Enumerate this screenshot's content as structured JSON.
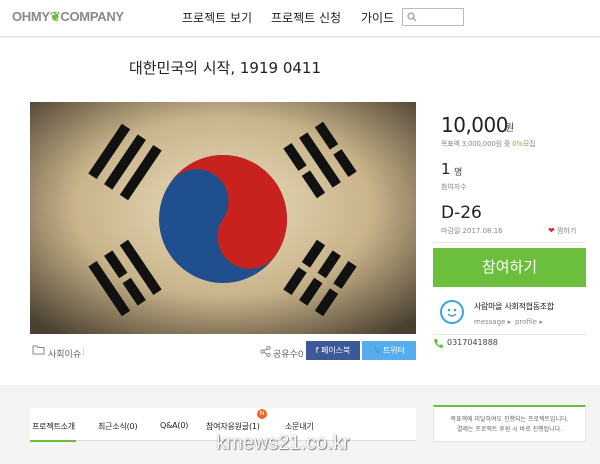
{
  "header": {
    "logo": {
      "part1": "OHMY",
      "part2": "COMPANY"
    },
    "nav": [
      "프로젝트 보기",
      "프로젝트 신청",
      "가이드"
    ],
    "search_placeholder": ""
  },
  "project": {
    "title": "대한민국의 시작, 1919 0411",
    "category": "사회이슈",
    "share_label": "공유수",
    "share_count": "0",
    "facebook_label": "페이스북",
    "twitter_label": "트위터"
  },
  "funding": {
    "amount": "10,000",
    "amount_unit": "원",
    "goal_prefix": "목표액 3,000,000원 중 ",
    "goal_percent": "0%",
    "goal_suffix": "모집",
    "supporters": "1",
    "supporters_unit": "명",
    "supporters_label": "참여자수",
    "dday": "D-26",
    "deadline": "마감일 2017.08.16",
    "like_label": "찜하기",
    "join_button": "참여하기"
  },
  "organizer": {
    "name": "사람마을 사회적협동조합",
    "message_link": "message ▸",
    "profile_link": "profile ▸",
    "phone": "0317041888"
  },
  "tabs": [
    {
      "label": "프로젝트소개",
      "active": true
    },
    {
      "label": "최근소식(0)",
      "active": false
    },
    {
      "label": "Q&A(0)",
      "active": false
    },
    {
      "label": "참여자응원글(1)",
      "active": false,
      "badge": "N"
    },
    {
      "label": "소문내기",
      "active": false
    }
  ],
  "notice": {
    "line1": "목표액에 미달하여도 진행되는 프로젝트입니다.",
    "line2": "결제는 프로젝트 후원 시 바로 진행됩니다."
  },
  "watermark": "kmews21.co.kr",
  "colors": {
    "accent": "#6bbf3c",
    "facebook": "#3b5998",
    "twitter": "#55acee",
    "heart": "#e0302b",
    "badge": "#f0642d"
  }
}
